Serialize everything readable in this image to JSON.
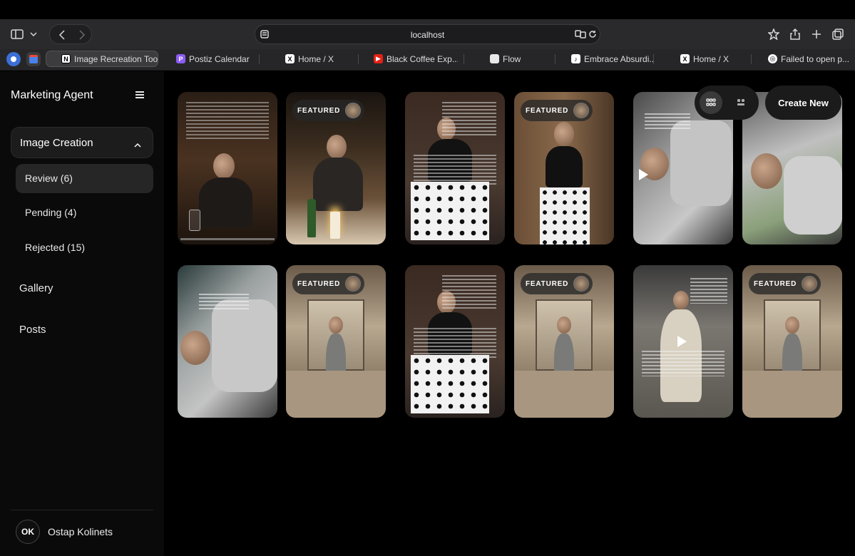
{
  "browser": {
    "url": "localhost",
    "tabs": [
      {
        "title": "Image Recreation Tool",
        "favicon": "notion-icon",
        "active": true
      },
      {
        "title": "Postiz Calendar",
        "favicon": "postiz-icon"
      },
      {
        "title": "Home / X",
        "favicon": "x-icon"
      },
      {
        "title": "Black Coffee Exp...",
        "favicon": "youtube-icon"
      },
      {
        "title": "Flow",
        "favicon": "folder-icon"
      },
      {
        "title": "Embrace Absurdi...",
        "favicon": "tiktok-icon"
      },
      {
        "title": "Home / X",
        "favicon": "x-icon"
      },
      {
        "title": "Failed to open p...",
        "favicon": "openai-icon"
      }
    ]
  },
  "sidebar": {
    "brand": "Marketing Agent",
    "section_label": "Image Creation",
    "sub_items": [
      "Review (6)",
      "Pending (4)",
      "Rejected (15)"
    ],
    "nav_items": [
      "Gallery",
      "Posts"
    ],
    "user": {
      "initials": "OK",
      "name": "Ostap Kolinets"
    }
  },
  "toolbar": {
    "create_label": "Create New"
  },
  "cards": {
    "featured_label": "FEATURED"
  },
  "colors": {
    "accent_bg": "#1c1c1c",
    "chrome_bg": "#2a2a2c"
  }
}
